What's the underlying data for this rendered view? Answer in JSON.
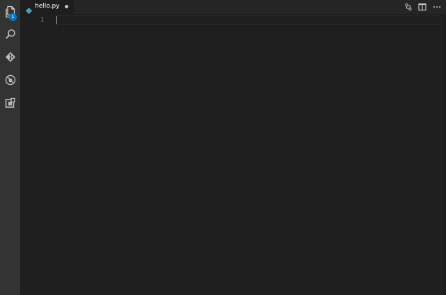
{
  "activity_bar": {
    "items": [
      {
        "name": "explorer",
        "icon": "files-icon",
        "badge": "1"
      },
      {
        "name": "search",
        "icon": "search-icon"
      },
      {
        "name": "source-control",
        "icon": "git-icon"
      },
      {
        "name": "debug",
        "icon": "debug-icon"
      },
      {
        "name": "extensions",
        "icon": "extensions-icon"
      }
    ]
  },
  "tabs": [
    {
      "label": "hello.py",
      "icon": "python-file-icon",
      "dirty": true
    }
  ],
  "editor_actions": [
    {
      "name": "open-changes",
      "icon": "open-changes-icon"
    },
    {
      "name": "split-editor",
      "icon": "split-editor-icon"
    },
    {
      "name": "more-actions",
      "icon": "ellipsis-icon"
    }
  ],
  "editor": {
    "line_numbers": [
      "1"
    ],
    "content": ""
  },
  "colors": {
    "activity_bar_bg": "#333333",
    "editor_bg": "#1e1e1e",
    "tab_strip_bg": "#252526",
    "badge": "#007acc",
    "line_number": "#858585"
  }
}
